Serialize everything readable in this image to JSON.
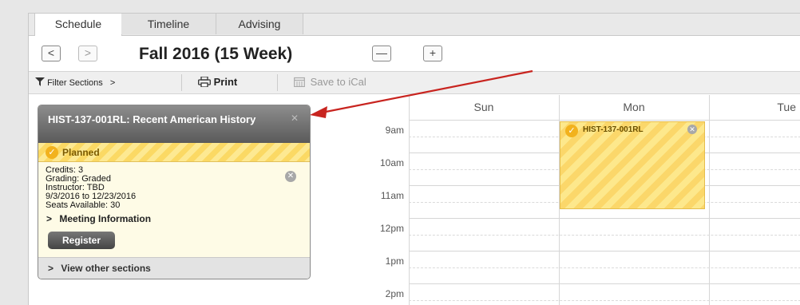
{
  "tabs": [
    {
      "label": "Schedule"
    },
    {
      "label": "Timeline"
    },
    {
      "label": "Advising"
    }
  ],
  "term": {
    "prev_icon": "<",
    "next_icon": ">",
    "title": "Fall 2016 (15 Week)",
    "minus_icon": "—",
    "plus_icon": "+"
  },
  "toolbar": {
    "filter_label": "Filter Sections",
    "filter_chevron": ">",
    "print_label": "Print",
    "ical_label": "Save to iCal"
  },
  "section_card": {
    "title": "HIST-137-001RL: Recent American History",
    "close_icon": "✕",
    "status": "Planned",
    "credits": "Credits: 3",
    "grading": "Grading: Graded",
    "instructor": "Instructor: TBD",
    "dates": "9/3/2016 to 12/23/2016",
    "seats": "Seats Available:  30",
    "meeting_label": "Meeting Information",
    "register_label": "Register",
    "other_sections_label": "View other sections"
  },
  "calendar": {
    "days": [
      "Sun",
      "Mon",
      "Tue"
    ],
    "hours": [
      "9am",
      "10am",
      "11am",
      "12pm",
      "1pm",
      "2pm"
    ],
    "event": {
      "label": "HIST-137-001RL",
      "day": "Mon",
      "start": "9am",
      "end": "11:30am"
    }
  },
  "colors": {
    "planned_yellow": "#fbd964",
    "check_orange": "#f2b21d",
    "arrow_red": "#c8241f",
    "card_header": "#6e6e6e"
  },
  "icons": {
    "filter": "filter-icon",
    "print": "printer-icon",
    "ical": "calendar-icon",
    "check": "checkmark-icon",
    "remove": "x-circle-icon"
  }
}
